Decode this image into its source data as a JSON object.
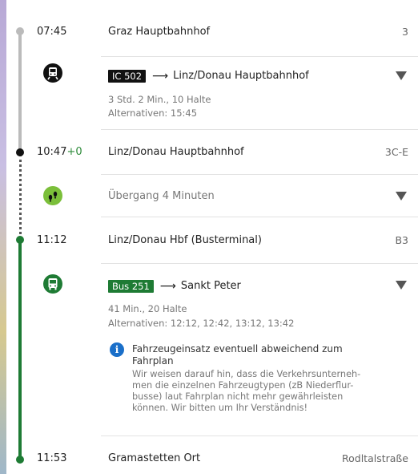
{
  "stops": [
    {
      "time": "07:45",
      "delay": "",
      "station": "Graz Hauptbahnhof",
      "track": "3"
    },
    {
      "time": "10:47",
      "delay": "+0",
      "station": "Linz/Donau Hauptbahnhof",
      "track": "3C-E"
    },
    {
      "time": "11:12",
      "delay": "",
      "station": "Linz/Donau Hbf (Busterminal)",
      "track": "B3"
    },
    {
      "time": "11:53",
      "delay": "",
      "station": "Gramastetten Ort",
      "track": "Rodltalstraße"
    }
  ],
  "legs": [
    {
      "line": "IC 502",
      "line_color": "#111111",
      "arrow": "⟶",
      "destination": "Linz/Donau Hauptbahnhof",
      "duration": "3 Std. 2 Min., 10 Halte",
      "alternatives": "Alternativen: 15:45",
      "icon": "train-icon"
    },
    {
      "transfer": "Übergang 4 Minuten",
      "icon": "walk-icon"
    },
    {
      "line": "Bus 251",
      "line_color": "#1e7b34",
      "arrow": "⟶",
      "destination": "Sankt Peter",
      "duration": "41 Min., 20 Halte",
      "alternatives": "Alternativen: 12:12, 12:42, 13:12, 13:42",
      "icon": "bus-icon",
      "notice_title": "Fahrzeugeinsatz eventuell abweichend zum Fahrplan",
      "notice_body": "Wir weisen darauf hin, dass die Verkehrsunterneh-men die einzelnen Fahrzeugtypen (zB Niederflur-busse) laut Fahrplan nicht mehr gewährleisten können. Wir bitten um Ihr Verständnis!"
    }
  ],
  "notice_lines": {
    "title": [
      "Fahrzeugeinsatz eventuell abweichend zum",
      "Fahrplan"
    ],
    "body": [
      "Wir weisen darauf hin, dass die Verkehrsunterneh-",
      "men die einzelnen Fahrzeugtypen (zB Niederflur-",
      "busse) laut Fahrplan nicht mehr gewährleisten",
      "können. Wir bitten um Ihr Verständnis!"
    ]
  },
  "info_glyph": "i",
  "colors": {
    "train_line": "#bbbbbb",
    "walk_line": "#555555",
    "bus_line": "#1e7b34",
    "walk_icon": "#7bbf3a",
    "bus_icon": "#1e7b34"
  }
}
